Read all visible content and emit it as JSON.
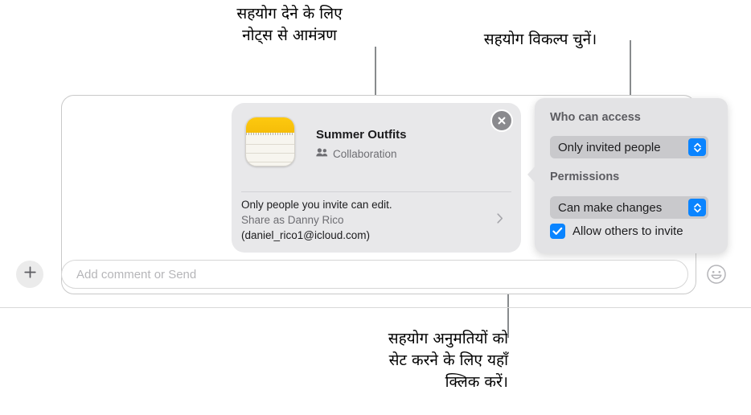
{
  "callouts": {
    "invite_from_notes": "सहयोग देने के लिए\nनोट्स से आमंत्रण",
    "choose_collab_option": "सहयोग विकल्प चुनें।",
    "click_here_to_set_permissions": "सहयोग अनुमतियों को\nसेट करने के लिए यहाँ\nक्लिक करें।"
  },
  "note_card": {
    "title": "Summer Outfits",
    "subtitle": "Collaboration",
    "people_icon": "people-icon",
    "close_icon": "close-icon",
    "access_line": "Only people you invite can edit.",
    "share_as": "Share as Danny Rico",
    "share_email": "(daniel_rico1@icloud.com)",
    "disclosure_icon": "chevron-right-icon",
    "app_icon": "notes-app-icon"
  },
  "popover": {
    "who_can_access_label": "Who can access",
    "who_can_access_value": "Only invited people",
    "permissions_label": "Permissions",
    "permissions_value": "Can make changes",
    "allow_others_to_invite_label": "Allow others to invite",
    "allow_others_to_invite_checked": true,
    "stepper_icon": "up-down-chevron-icon",
    "checkbox_icon": "checkmark-icon"
  },
  "composer": {
    "add_icon": "plus-icon",
    "placeholder": "Add comment or Send",
    "value": "",
    "emoji_icon": "smiley-face-icon"
  },
  "colors": {
    "accent_blue": "#0a84ff",
    "notes_yellow": "#f6bd09",
    "popover_bg": "#e3e3e5",
    "card_bg": "#e8e8ea",
    "leader_line": "#888b8d"
  }
}
